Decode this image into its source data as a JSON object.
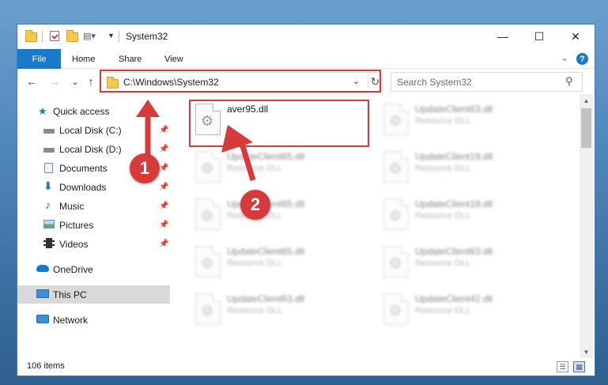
{
  "window": {
    "title": "System32",
    "minimize": "—",
    "maximize": "☐",
    "close": "✕"
  },
  "ribbon": {
    "file": "File",
    "tabs": [
      "Home",
      "Share",
      "View"
    ],
    "expand": "⌄",
    "help": "?"
  },
  "nav": {
    "back": "←",
    "forward": "→",
    "recent": "⌄",
    "up": "↑"
  },
  "address": {
    "path": "C:\\Windows\\System32",
    "dropdown": "⌄",
    "refresh": "↻"
  },
  "search": {
    "placeholder": "Search System32",
    "icon": "⚲"
  },
  "sidebar": {
    "items": [
      {
        "label": "Quick access",
        "icon": "star-icon"
      },
      {
        "label": "Local Disk (C:)",
        "icon": "drive-icon"
      },
      {
        "label": "Local Disk (D:)",
        "icon": "drive-icon"
      },
      {
        "label": "Documents",
        "icon": "document-icon"
      },
      {
        "label": "Downloads",
        "icon": "download-icon"
      },
      {
        "label": "Music",
        "icon": "music-icon"
      },
      {
        "label": "Pictures",
        "icon": "pictures-icon"
      },
      {
        "label": "Videos",
        "icon": "video-icon"
      },
      {
        "label": "OneDrive",
        "icon": "cloud-icon"
      },
      {
        "label": "This PC",
        "icon": "computer-icon"
      },
      {
        "label": "Network",
        "icon": "network-icon"
      }
    ],
    "pin": "📌"
  },
  "files": {
    "highlighted": {
      "name": "aver95.dll"
    },
    "items": [
      {
        "name": "UpdateClient63.dll",
        "type": "Resource DLL"
      },
      {
        "name": "UpdateClient65.dll",
        "type": "Resource DLL"
      },
      {
        "name": "UpdateClient19.dll",
        "type": "Resource DLL"
      },
      {
        "name": "UpdateClient65.dll",
        "type": "Resource DLL"
      },
      {
        "name": "UpdateClient19.dll",
        "type": "Resource DLL"
      },
      {
        "name": "UpdateClient65.dll",
        "type": "Resource DLL"
      },
      {
        "name": "UpdateClient63.dll",
        "type": "Resource DLL"
      },
      {
        "name": "UpdateClient63.dll",
        "type": "Resource DLL"
      },
      {
        "name": "UpdateClient42.dll",
        "type": "Resource DLL"
      }
    ]
  },
  "status": {
    "count": "106 items"
  },
  "annotations": {
    "step1": "1",
    "step2": "2",
    "color": "#d63a3a"
  },
  "colors": {
    "accent": "#1979ca",
    "highlight": "#d63a3a"
  }
}
